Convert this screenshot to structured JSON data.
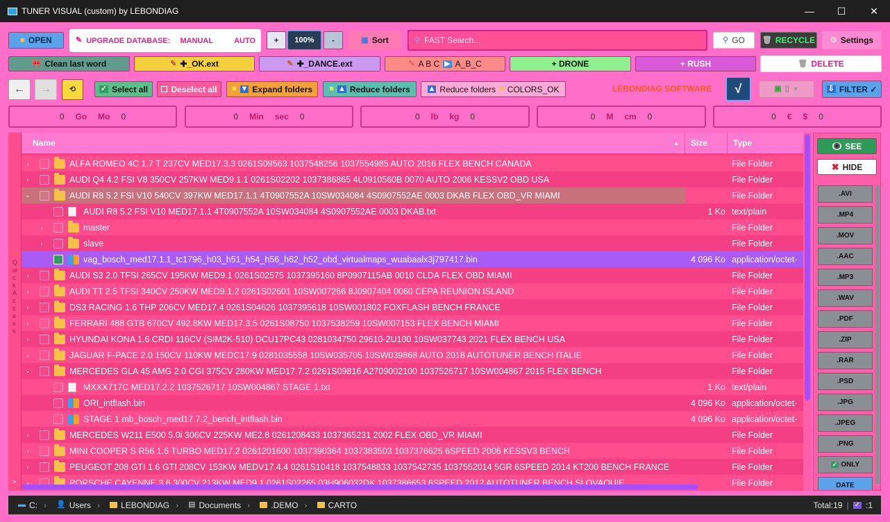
{
  "window": {
    "title": "TUNER VISUAL (custom) by LEBONDIAG",
    "minimize": "—",
    "maximize": "☐",
    "close": "✕"
  },
  "toolbar1": {
    "open": "OPEN",
    "upgrade_label": "UPGRADE DATABASE:",
    "manual": "MANUAL",
    "auto": "AUTO",
    "zoom_plus": "+",
    "zoom_value": "100%",
    "zoom_minus": "-",
    "sort": "Sort",
    "search_placeholder": "FAST Search...",
    "go": "GO",
    "recycle": "RECYCLE",
    "settings": "Settings"
  },
  "toolbar2": {
    "clean": "Clean last word",
    "ok_ext": "✚_OK.ext",
    "dance_ext": "✚_DANCE.ext",
    "abc": "A B C",
    "abc2": "A_B_C",
    "drone": "+    DRONE",
    "rush": "+    RUSH",
    "delete": "DELETE"
  },
  "toolbar3": {
    "back": "←",
    "forward": "→",
    "select_all": "Select all",
    "deselect_all": "Deselect all",
    "expand": "Expand folders",
    "reduce": "Reduce folders",
    "reduce_colors": "Reduce folders",
    "colors_ok": "COLORS_OK",
    "brand": "LEBONDIAG SOFTWARE",
    "check": "√",
    "filter": "FILTER ✓"
  },
  "units": [
    {
      "a": "Go",
      "b": "Mo",
      "va": "0",
      "vb": "0"
    },
    {
      "a": "Min",
      "b": "sec",
      "va": "0",
      "vb": "0"
    },
    {
      "a": "lb",
      "b": "kg",
      "va": "0",
      "vb": "0"
    },
    {
      "a": "M",
      "b": "cm",
      "va": "0",
      "vb": "0"
    },
    {
      "a": "€",
      "b": "$",
      "va": "0",
      "vb": "0"
    }
  ],
  "quick_access": "Quick Access",
  "columns": {
    "name": "Name",
    "size": "Size",
    "type": "Type"
  },
  "rows": [
    {
      "level": 0,
      "exp": "›",
      "icon": "folder",
      "name": "ALFA ROMEO 4C 1.7 T 237CV MED17.3.3 0261S09563 1037548256 1037554985 AUTO 2016 FLEX BENCH CANADA",
      "size": "",
      "type": "File Folder"
    },
    {
      "level": 0,
      "exp": "›",
      "icon": "folder",
      "name": "AUDI Q4 4.2 FSI V8 350CV 257KW MED9.1.1 0261S02202 1037386865 4L0910560B 0070 AUTO 2006 KESSV2 OBD USA",
      "size": "",
      "type": "File Folder"
    },
    {
      "level": 0,
      "exp": "⌄",
      "icon": "folder",
      "name": "AUDI R8 5.2 FSI V10 540CV 397KW MED17.1.1 4T0907552A 10SW034084 4S0907552AE 0003 DKAB FLEX OBD_VR MIAMI",
      "size": "",
      "type": "File Folder",
      "hl": "grey"
    },
    {
      "level": 1,
      "exp": "",
      "icon": "file",
      "name": "AUDI R8 5.2 FSI V10 MED17.1.1 4T0907552A 10SW034084 4S0907552AE 0003 DKAB.txt",
      "size": "1 Ko",
      "type": "text/plain"
    },
    {
      "level": 1,
      "exp": "›",
      "icon": "folder",
      "name": "master",
      "size": "",
      "type": "File Folder"
    },
    {
      "level": 1,
      "exp": "›",
      "icon": "folder",
      "name": "slave",
      "size": "",
      "type": "File Folder"
    },
    {
      "level": 1,
      "exp": "",
      "icon": "bin",
      "name": "vag_bosch_med17.1.1_tc1796_h03_h51_h54_h56_h62_h52_obd_virtualmaps_wuabaalx3j797417.bin",
      "size": "4 096 Ko",
      "type": "application/octet-",
      "hl": "purple",
      "checked": true
    },
    {
      "level": 0,
      "exp": "›",
      "icon": "folder",
      "name": "AUDI S3 2.0 TFSI 265CV 195KW MED9.1 0261S02575 1037395160 8P0907115AB 0010 CLDA FLEX OBD MIAMI",
      "size": "",
      "type": "File Folder"
    },
    {
      "level": 0,
      "exp": "›",
      "icon": "folder",
      "name": "AUDI TT 2.5 TFSI 340CV 250KW MED9.1.2 0261S02601 10SW007266 8J0907404 0060 CEPA REUNION ISLAND",
      "size": "",
      "type": "File Folder"
    },
    {
      "level": 0,
      "exp": "›",
      "icon": "folder",
      "name": "DS3 RACING 1.6 THP 206CV MED17.4 0261S04626 1037395618 10SW001802 FOXFLASH BENCH FRANCE",
      "size": "",
      "type": "File Folder"
    },
    {
      "level": 0,
      "exp": "›",
      "icon": "folder",
      "name": "FERRARI 488 GTB 670CV 492.8KW MED17.3.5 0261S08750 1037538259 10SW007153 FLEX BENCH MIAMI",
      "size": "",
      "type": "File Folder"
    },
    {
      "level": 0,
      "exp": "›",
      "icon": "folder",
      "name": "HYUNDAI KONA 1.6 CRDI 116CV (SIM2K-510) DCU17PC43 0281034750 29610-2U100 10SW037743 2021 FLEX BENCH USA",
      "size": "",
      "type": "File Folder"
    },
    {
      "level": 0,
      "exp": "›",
      "icon": "folder",
      "name": "JAGUAR F-PACE 2.0 150CV 110KW MEDC17.9 0281035558 10SW035705 10SW039868 AUTO 2018 AUTOTUNER BENCH ITALIE",
      "size": "",
      "type": "File Folder"
    },
    {
      "level": 0,
      "exp": "⌄",
      "icon": "folder",
      "name": "MERCEDES GLA 45 AMG 2.0 CGI 375CV 280KW MED17.7.2 0261S09816 A2709002100 1037526717 10SW004867 2015 FLEX BENCH",
      "size": "",
      "type": "File Folder"
    },
    {
      "level": 1,
      "exp": "",
      "icon": "file",
      "name": "MXXX717C MED17.2.2 1037526717 10SW004867 STAGE 1.txt",
      "size": "1 Ko",
      "type": "text/plain"
    },
    {
      "level": 1,
      "exp": "",
      "icon": "bin",
      "name": "ORI_intflash.bin",
      "size": "4 096 Ko",
      "type": "application/octet-"
    },
    {
      "level": 1,
      "exp": "",
      "icon": "bin",
      "name": "STAGE 1 mb_bosch_med17.7.2_bench_intflash.bin",
      "size": "4 096 Ko",
      "type": "application/octet-"
    },
    {
      "level": 0,
      "exp": "›",
      "icon": "folder",
      "name": "MERCEDES W211 E500 5.0i 306CV 225KW ME2.8 0261208433 1037365231 2002 FLEX OBD_VR MIAMI",
      "size": "",
      "type": "File Folder"
    },
    {
      "level": 0,
      "exp": "›",
      "icon": "folder",
      "name": "MINI COOPER S R56 1.6 TURBO MED17.2 0261201600 1037390364 1037383503 1037376625 6SPEED 2006 KESSV3 BENCH",
      "size": "",
      "type": "File Folder"
    },
    {
      "level": 0,
      "exp": "›",
      "icon": "folder",
      "name": "PEUGEOT 208 GTI 1.6 GTI 208CV 153KW MEDV17.4.4 0261S10418 1037548833 1037542735 1037552014 5GR 6SPEED 2014 KT200 BENCH FRANCE",
      "size": "",
      "type": "File Folder"
    },
    {
      "level": 0,
      "exp": "›",
      "icon": "folder",
      "name": "PORSCHE CAYENNE 3.6 300CV 213KW MED9.1 0261S02265 03H906032DK 1037386653 6SPEED 2012 AUTOTUNER BENCH SLOVAQUIE",
      "size": "",
      "type": "File Folder"
    }
  ],
  "side": {
    "see": "SEE",
    "hide": "HIDE",
    "exts": [
      ".AVI",
      ".MP4",
      ".MOV",
      ".AAC",
      ".MP3",
      ".WAV",
      ".PDF",
      ".ZIP",
      ".RAR",
      ".PSD",
      ".JPG",
      ".JPEG",
      ".PNG",
      "ONLY",
      "DATE"
    ]
  },
  "status": {
    "crumbs": [
      "C:",
      "Users",
      "LEBONDIAG",
      "Documents",
      ".DEMO",
      "CARTO"
    ],
    "total": "Total:19",
    "selected": ":1"
  }
}
